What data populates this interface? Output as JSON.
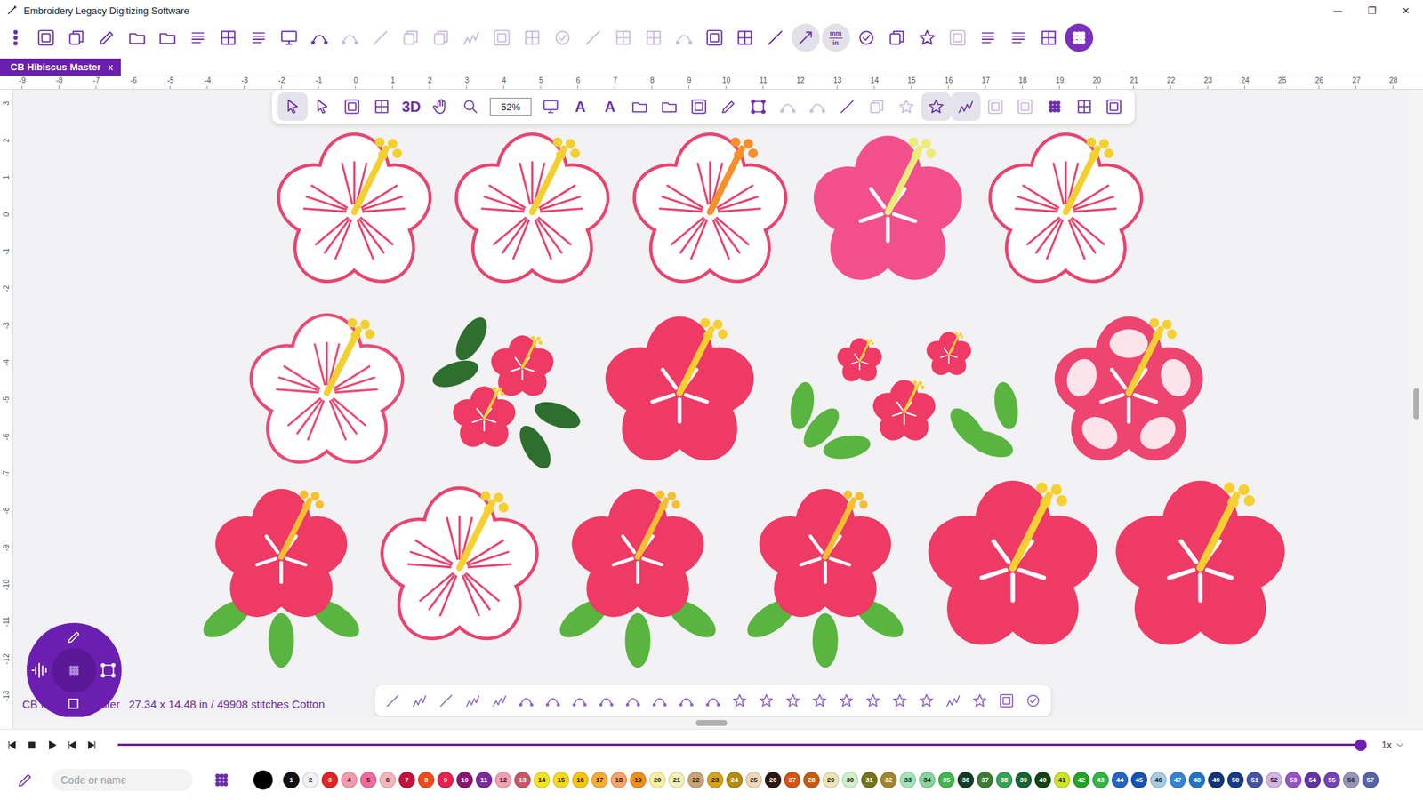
{
  "window": {
    "title": "Embroidery Legacy Digitizing Software",
    "controls": [
      "—",
      "❐",
      "✕"
    ]
  },
  "main_toolbar": [
    {
      "on": false,
      "disabled": false
    },
    {
      "on": false,
      "disabled": false
    },
    {
      "on": false,
      "disabled": false
    },
    {
      "on": false,
      "disabled": false
    },
    {
      "on": false,
      "disabled": false
    },
    {
      "on": false,
      "disabled": false
    },
    {
      "on": false,
      "disabled": false
    },
    {
      "on": false,
      "disabled": false
    },
    {
      "on": false,
      "disabled": false
    },
    {
      "on": false,
      "disabled": false
    },
    {
      "on": false,
      "disabled": false
    },
    {
      "on": false,
      "disabled": true
    },
    {
      "on": false,
      "disabled": true
    },
    {
      "on": false,
      "disabled": true
    },
    {
      "on": false,
      "disabled": true
    },
    {
      "on": false,
      "disabled": true
    },
    {
      "on": false,
      "disabled": true
    },
    {
      "on": false,
      "disabled": true
    },
    {
      "on": false,
      "disabled": true
    },
    {
      "on": false,
      "disabled": true
    },
    {
      "on": false,
      "disabled": true
    },
    {
      "on": false,
      "disabled": true
    },
    {
      "on": false,
      "disabled": true
    },
    {
      "on": false,
      "disabled": false
    },
    {
      "on": false,
      "disabled": false
    },
    {
      "on": false,
      "disabled": false
    },
    {
      "on": true,
      "disabled": false
    },
    {
      "on": true,
      "disabled": false,
      "top": "mm",
      "bottom": "in"
    },
    {
      "on": false,
      "disabled": false
    },
    {
      "on": false,
      "disabled": false
    },
    {
      "on": false,
      "disabled": false
    },
    {
      "on": false,
      "disabled": true
    },
    {
      "on": false,
      "disabled": false
    },
    {
      "on": false,
      "disabled": false
    },
    {
      "on": false,
      "disabled": false
    },
    {
      "on": true,
      "disabled": false,
      "accent": true
    }
  ],
  "tabs": [
    {
      "label": "CB Hibiscus Master",
      "close": "x",
      "selected": true
    }
  ],
  "ruler": {
    "horizontal": [
      "-9",
      "-8",
      "-7",
      "-6",
      "-5",
      "-4",
      "-3",
      "-2",
      "-1",
      "0",
      "1",
      "2",
      "3",
      "4",
      "5",
      "6",
      "7",
      "8",
      "9",
      "10",
      "11",
      "12",
      "13",
      "14",
      "15",
      "16",
      "17",
      "18",
      "19",
      "20",
      "21",
      "22",
      "23",
      "24",
      "25",
      "26",
      "27",
      "28"
    ],
    "vertical": [
      "3",
      "2",
      "1",
      "0",
      "-1",
      "-2",
      "-3",
      "-4",
      "-5",
      "-6",
      "-7",
      "-8",
      "-9",
      "-10",
      "-11",
      "-12",
      "-13"
    ]
  },
  "float_toolbar": [
    {
      "kind": "icon",
      "on": true,
      "disabled": false
    },
    {
      "kind": "icon",
      "on": false,
      "disabled": false
    },
    {
      "kind": "icon",
      "on": false,
      "disabled": false
    },
    {
      "kind": "icon",
      "on": false,
      "disabled": false
    },
    {
      "kind": "label",
      "text": "3D",
      "on": false,
      "disabled": false
    },
    {
      "kind": "icon",
      "on": false,
      "disabled": false
    },
    {
      "kind": "icon",
      "on": false,
      "disabled": false
    },
    {
      "kind": "zoom",
      "text": "52%",
      "on": false,
      "disabled": false
    },
    {
      "kind": "icon",
      "on": false,
      "disabled": false
    },
    {
      "kind": "label",
      "text": "A",
      "on": false,
      "disabled": false
    },
    {
      "kind": "label",
      "text": "A",
      "on": false,
      "disabled": false
    },
    {
      "kind": "icon",
      "on": false,
      "disabled": false
    },
    {
      "kind": "icon",
      "on": false,
      "disabled": false
    },
    {
      "kind": "icon",
      "on": false,
      "disabled": false
    },
    {
      "kind": "icon",
      "on": false,
      "disabled": false
    },
    {
      "kind": "icon",
      "on": false,
      "disabled": false
    },
    {
      "kind": "icon",
      "on": false,
      "disabled": true
    },
    {
      "kind": "icon",
      "on": false,
      "disabled": true
    },
    {
      "kind": "icon",
      "on": false,
      "disabled": false
    },
    {
      "kind": "icon",
      "on": false,
      "disabled": true
    },
    {
      "kind": "icon",
      "on": false,
      "disabled": true
    },
    {
      "kind": "icon",
      "on": true,
      "disabled": false
    },
    {
      "kind": "icon",
      "on": true,
      "disabled": false
    },
    {
      "kind": "icon",
      "on": false,
      "disabled": true
    },
    {
      "kind": "icon",
      "on": false,
      "disabled": true
    },
    {
      "kind": "icon",
      "on": false,
      "disabled": false
    },
    {
      "kind": "icon",
      "on": false,
      "disabled": false
    },
    {
      "kind": "icon",
      "on": false,
      "disabled": false
    }
  ],
  "flower_rows": [
    [
      {
        "kind": "outline",
        "petal": "#e8446e",
        "stamen": "#f2d030",
        "leaves": false
      },
      {
        "kind": "outline",
        "petal": "#e8446e",
        "stamen": "#f2d030",
        "leaves": false
      },
      {
        "kind": "outline",
        "petal": "#e8446e",
        "stamen": "#f5902a",
        "leaves": false
      },
      {
        "kind": "filled",
        "petal": "#f2508c",
        "stamen": "#ecec78",
        "leaves": false
      },
      {
        "kind": "outline",
        "petal": "#e8446e",
        "stamen": "#f2d030",
        "leaves": false
      }
    ],
    [
      {
        "kind": "outline",
        "petal": "#ea4a74",
        "stamen": "#f2d030",
        "leaves": false
      },
      {
        "kind": "cluster",
        "petal": "#ee3a64",
        "stamen": "#f5d030",
        "leaves": true,
        "leaf": "#2e6e2e"
      },
      {
        "kind": "filled",
        "petal": "#f03a66",
        "stamen": "#f5d030",
        "leaves": false
      },
      {
        "kind": "bouquet",
        "petal": "#ee3a64",
        "stamen": "#f5d030",
        "leaves": true,
        "leaf": "#5ab440"
      },
      {
        "kind": "ruffled",
        "petal": "#ee4470",
        "stamen": "#f5d030",
        "leaves": false
      }
    ],
    [
      {
        "kind": "filled",
        "petal": "#ee3a64",
        "stamen": "#f5c030",
        "leaves": true,
        "leaf": "#5ab440"
      },
      {
        "kind": "outline",
        "petal": "#e8446e",
        "stamen": "#f5d030",
        "leaves": false
      },
      {
        "kind": "filled",
        "petal": "#ee3a64",
        "stamen": "#f5c030",
        "leaves": true,
        "leaf": "#5ab440"
      },
      {
        "kind": "filled",
        "petal": "#ee3a64",
        "stamen": "#f5c030",
        "leaves": true,
        "leaf": "#5ab440"
      },
      {
        "kind": "filled",
        "petal": "#f03a66",
        "stamen": "#f5d030",
        "leaves": false
      },
      {
        "kind": "filled",
        "petal": "#f03a66",
        "stamen": "#f5d030",
        "leaves": false
      }
    ]
  ],
  "widget": {
    "checked": false
  },
  "status": {
    "name": "CB Hibiscus Master",
    "info": "27.34 x 14.48 in / 49908 stitches Cotton"
  },
  "scroll": {
    "vertical": 0.49,
    "horizontal": 0.5
  },
  "playback": {
    "level": 1,
    "speed": "1x"
  },
  "palette": {
    "placeholder": "Code or name",
    "current": "#000000",
    "threads": [
      {
        "code": "1",
        "color": "#111111"
      },
      {
        "code": "2",
        "color": "#f2f2f2"
      },
      {
        "code": "3",
        "color": "#e02424"
      },
      {
        "code": "4",
        "color": "#f49ab0"
      },
      {
        "code": "5",
        "color": "#f06ca0"
      },
      {
        "code": "6",
        "color": "#f4b6bc"
      },
      {
        "code": "7",
        "color": "#c8103c"
      },
      {
        "code": "8",
        "color": "#f04a1e"
      },
      {
        "code": "9",
        "color": "#e8204e"
      },
      {
        "code": "10",
        "color": "#8c1470"
      },
      {
        "code": "11",
        "color": "#7a2c9c"
      },
      {
        "code": "12",
        "color": "#f4a0b0"
      },
      {
        "code": "13",
        "color": "#c85868"
      },
      {
        "code": "14",
        "color": "#f4e41c"
      },
      {
        "code": "15",
        "color": "#f8d81c"
      },
      {
        "code": "16",
        "color": "#f8c40c"
      },
      {
        "code": "17",
        "color": "#f8ac34"
      },
      {
        "code": "18",
        "color": "#f8a468"
      },
      {
        "code": "19",
        "color": "#f0901c"
      },
      {
        "code": "20",
        "color": "#f8f0a0"
      },
      {
        "code": "21",
        "color": "#f4f0b8"
      },
      {
        "code": "22",
        "color": "#c8a474"
      },
      {
        "code": "23",
        "color": "#d4a41c"
      },
      {
        "code": "24",
        "color": "#b48c10"
      },
      {
        "code": "25",
        "color": "#f0d8b4"
      },
      {
        "code": "26",
        "color": "#2c1a10"
      },
      {
        "code": "27",
        "color": "#d45414"
      },
      {
        "code": "28",
        "color": "#c45c14"
      },
      {
        "code": "29",
        "color": "#ece4b4"
      },
      {
        "code": "30",
        "color": "#ccf2cc"
      },
      {
        "code": "31",
        "color": "#74741c"
      },
      {
        "code": "32",
        "color": "#a4842c"
      },
      {
        "code": "33",
        "color": "#a4e4b8"
      },
      {
        "code": "34",
        "color": "#88d49c"
      },
      {
        "code": "35",
        "color": "#44b44c"
      },
      {
        "code": "36",
        "color": "#143c24"
      },
      {
        "code": "37",
        "color": "#3c7c34"
      },
      {
        "code": "38",
        "color": "#34a458"
      },
      {
        "code": "39",
        "color": "#146434"
      },
      {
        "code": "40",
        "color": "#144414"
      },
      {
        "code": "41",
        "color": "#cce424"
      },
      {
        "code": "42",
        "color": "#24a424"
      },
      {
        "code": "43",
        "color": "#34b444"
      },
      {
        "code": "44",
        "color": "#2464c4"
      },
      {
        "code": "45",
        "color": "#1454b4"
      },
      {
        "code": "46",
        "color": "#a4cce4"
      },
      {
        "code": "47",
        "color": "#3484d4"
      },
      {
        "code": "48",
        "color": "#2474c4"
      },
      {
        "code": "49",
        "color": "#143474"
      },
      {
        "code": "50",
        "color": "#143c84"
      },
      {
        "code": "51",
        "color": "#4454a4"
      },
      {
        "code": "52",
        "color": "#d4b4e4"
      },
      {
        "code": "53",
        "color": "#9454c4"
      },
      {
        "code": "54",
        "color": "#6434a4"
      },
      {
        "code": "55",
        "color": "#7444b4"
      },
      {
        "code": "56",
        "color": "#9494b4"
      },
      {
        "code": "57",
        "color": "#5464a4"
      }
    ]
  }
}
